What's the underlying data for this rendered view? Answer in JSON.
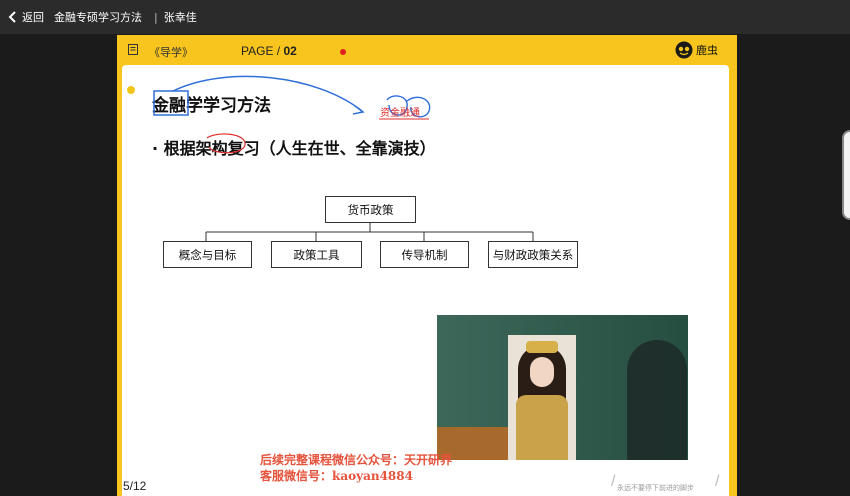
{
  "topbar": {
    "back_label": "返回",
    "course_title": "金融专硕学习方法",
    "separator": "|",
    "teacher": "张幸佳"
  },
  "slide": {
    "guide_label": "《导学》",
    "page_prefix": "PAGE /",
    "page_number": "02",
    "brand_name": "鹿虫",
    "title": "金融学学习方法",
    "subtitle": "·  根据架构复习（人生在世、全靠演技）",
    "annotation_text": "资金融通",
    "diagram": {
      "root": "货币政策",
      "children": [
        "概念与目标",
        "政策工具",
        "传导机制",
        "与财政政策关系"
      ]
    },
    "watermark_line1": "后续完整课程微信公众号：天开研界",
    "watermark_line2": "客服微信号：kaoyan4884",
    "page_counter": "5/12",
    "motto": "永远不要停下前进的脚步"
  },
  "colors": {
    "slide_frame": "#f7c51d",
    "topbar": "#2b2b2b",
    "annotation_blue": "#2f6fd8",
    "annotation_red": "#e02a2a",
    "watermark": "#e5533c"
  },
  "icons": [
    "back-chevron-icon",
    "book-icon",
    "brand-logo-icon"
  ]
}
